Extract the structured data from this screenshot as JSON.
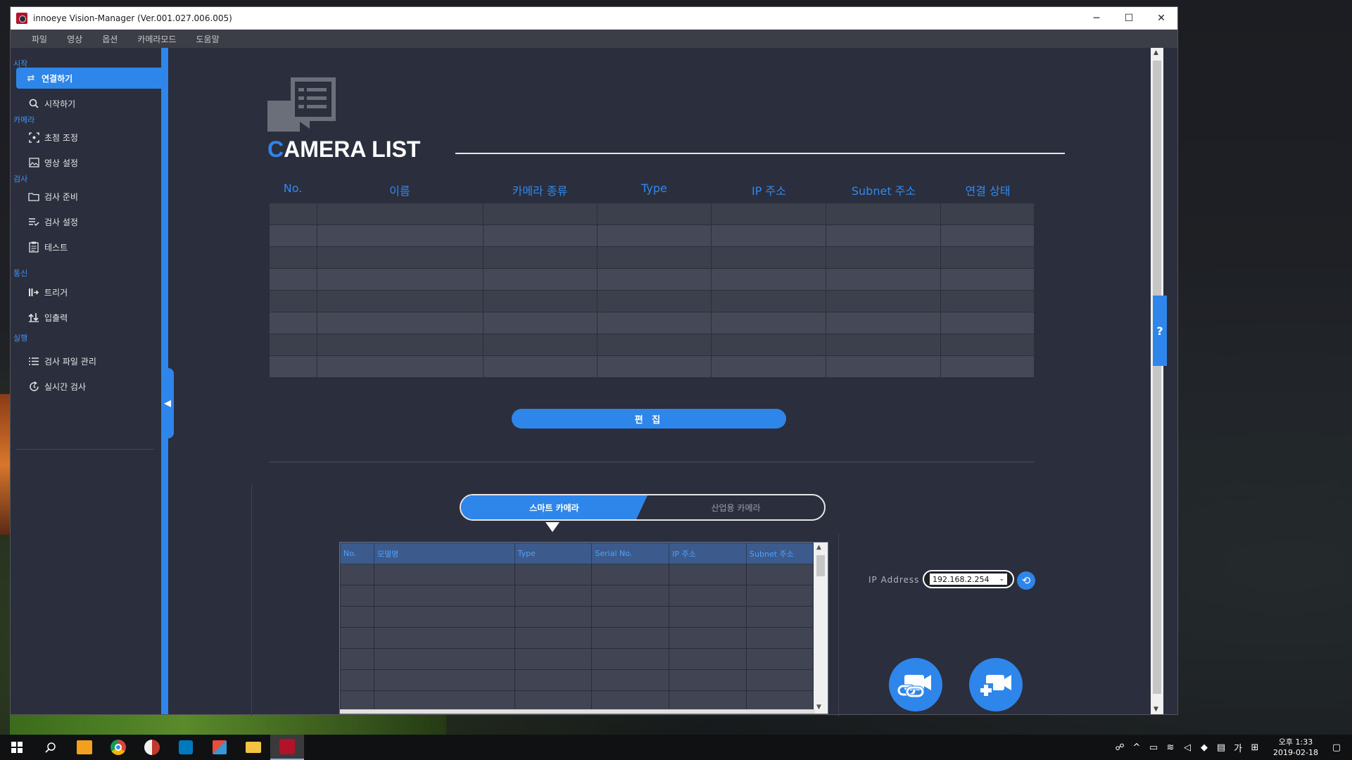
{
  "window": {
    "title": "innoeye Vision-Manager (Ver.001.027.006.005)",
    "minimize": "─",
    "maximize": "☐",
    "close": "✕"
  },
  "menu": [
    "파일",
    "영상",
    "옵션",
    "카메라모드",
    "도움말"
  ],
  "sidebar": {
    "sections": [
      {
        "label": "시작",
        "items": [
          {
            "label": "연결하기",
            "icon": "swap-icon",
            "active": true
          },
          {
            "label": "시작하기",
            "icon": "search-icon",
            "active": false
          }
        ]
      },
      {
        "label": "카메라",
        "items": [
          {
            "label": "초점 조정",
            "icon": "focus-icon",
            "active": false
          },
          {
            "label": "영상 설정",
            "icon": "image-icon",
            "active": false
          }
        ]
      },
      {
        "label": "검사",
        "items": [
          {
            "label": "검사 준비",
            "icon": "folder-icon",
            "active": false
          },
          {
            "label": "검사 설정",
            "icon": "list-check-icon",
            "active": false
          },
          {
            "label": "테스트",
            "icon": "clipboard-icon",
            "active": false
          }
        ]
      },
      {
        "label": "통신",
        "items": [
          {
            "label": "트리거",
            "icon": "trigger-icon",
            "active": false
          },
          {
            "label": "입출력",
            "icon": "io-icon",
            "active": false
          }
        ]
      },
      {
        "label": "실행",
        "items": [
          {
            "label": "검사 파일 관리",
            "icon": "list-icon",
            "active": false
          },
          {
            "label": "실시간 검사",
            "icon": "refresh-clock-icon",
            "active": false
          }
        ]
      }
    ]
  },
  "camera_list": {
    "title_first": "C",
    "title_rest": "AMERA LIST",
    "columns": [
      "No.",
      "이름",
      "카메라 종류",
      "Type",
      "IP 주소",
      "Subnet 주소",
      "연결 상태"
    ],
    "row_count": 8,
    "edit_button": "편 집"
  },
  "camera_tabs": {
    "smart": "스마트 카메라",
    "industrial": "산업용 카메라"
  },
  "scan_table": {
    "columns": [
      "No.",
      "모델명",
      "Type",
      "Serial No.",
      "IP 주소",
      "Subnet 주소"
    ],
    "row_count": 7
  },
  "ip": {
    "label": "IP Address",
    "value": "192.168.2.254"
  },
  "help": "?",
  "taskbar": {
    "time": "오후 1:33",
    "date": "2019-02-18",
    "ime": "가"
  },
  "colors": {
    "accent": "#2e86ea",
    "background": "#2b2e3c"
  }
}
